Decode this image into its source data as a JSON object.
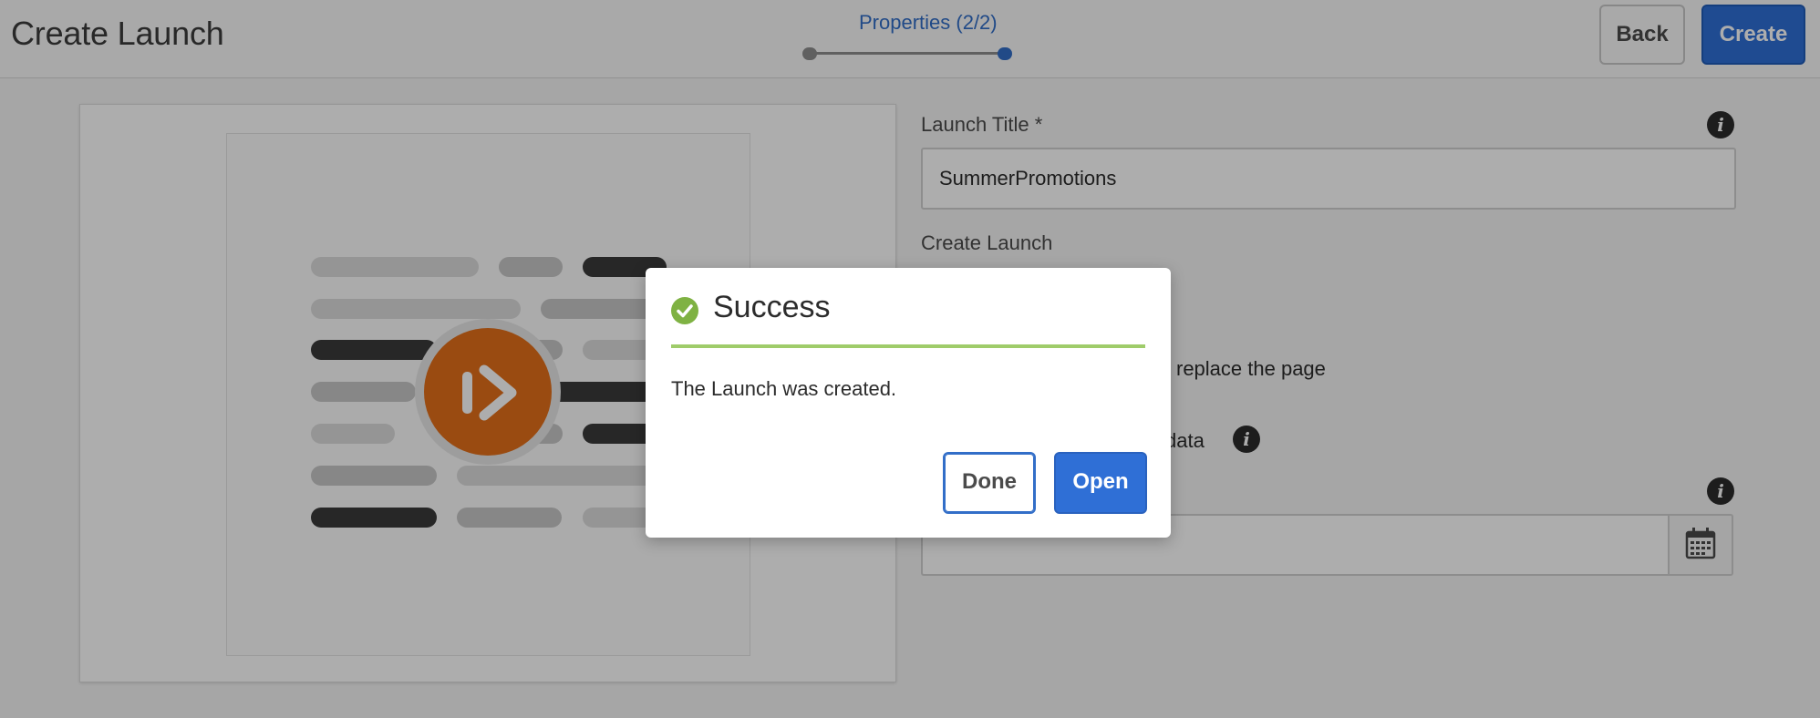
{
  "header": {
    "title": "Create Launch",
    "wizard_step": "Properties (2/2)",
    "back_label": "Back",
    "create_label": "Create"
  },
  "form": {
    "launch_title_label": "Launch Title *",
    "launch_title_value": "SummerPromotions",
    "create_launch_label": "Create Launch",
    "replace_page_text": "replace the page",
    "data_text": "data"
  },
  "icons": {
    "info": "info-icon",
    "calendar": "calendar-icon",
    "launch": "launch-icon",
    "success": "checkmark-circle-icon"
  },
  "dialog": {
    "title": "Success",
    "message": "The Launch was created.",
    "done_label": "Done",
    "open_label": "Open"
  },
  "colors": {
    "accent": "#326ec8",
    "success": "#7fb243",
    "launch_orange": "#e36f1a"
  }
}
